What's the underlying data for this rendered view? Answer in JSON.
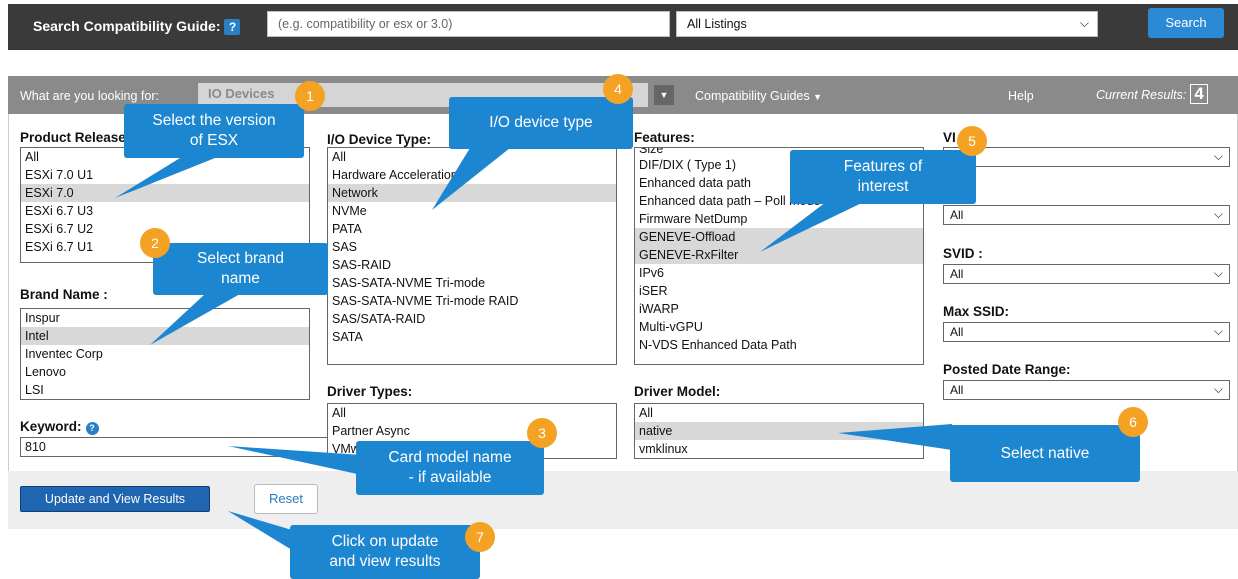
{
  "search_bar": {
    "label": "Search Compatibility Guide:",
    "help_icon": "?",
    "input_placeholder": "(e.g. compatibility or esx or 3.0)",
    "listing_value": "All Listings",
    "search_button": "Search"
  },
  "navbar": {
    "looking_for_label": "What are you looking for:",
    "looking_for_value": "IO Devices",
    "compatibility_guides": "Compatibility Guides",
    "help": "Help",
    "current_results_label": "Current Results:",
    "current_results_value": "4"
  },
  "product_release": {
    "label": "Product Release",
    "items": [
      "All",
      "ESXi 7.0 U1",
      "ESXi 7.0",
      "ESXi 6.7 U3",
      "ESXi 6.7 U2",
      "ESXi 6.7 U1"
    ]
  },
  "brand_name": {
    "label": "Brand Name :",
    "items": [
      "Inspur",
      "Intel",
      "Inventec Corp",
      "Lenovo",
      "LSI"
    ]
  },
  "keyword": {
    "label": "Keyword:",
    "value": "810"
  },
  "io_device_type": {
    "label": "I/O Device Type:",
    "items": [
      "All",
      "Hardware Acceleration",
      "Network",
      "NVMe",
      "PATA",
      "SAS",
      "SAS-RAID",
      "SAS-SATA-NVME Tri-mode",
      "SAS-SATA-NVME Tri-mode RAID",
      "SAS/SATA-RAID",
      "SATA"
    ]
  },
  "driver_types": {
    "label": "Driver Types:",
    "items": [
      "All",
      "Partner Async",
      "VMware Inbox"
    ]
  },
  "features": {
    "label": "Features:",
    "items": [
      "Size",
      "DIF/DIX ( Type 1)",
      "Enhanced data path",
      "Enhanced data path – Poll mode",
      "Firmware NetDump",
      "GENEVE-Offload",
      "GENEVE-RxFilter",
      "IPv6",
      "iSER",
      "iWARP",
      "Multi-vGPU",
      "N-VDS Enhanced Data Path"
    ]
  },
  "driver_model": {
    "label": "Driver Model:",
    "items": [
      "All",
      "native",
      "vmklinux"
    ]
  },
  "right_filters": {
    "vid_label": "VI",
    "ssid_value": "All",
    "svid_label": "SVID :",
    "svid_value": "All",
    "max_ssid_label": "Max SSID:",
    "max_ssid_value": "All",
    "posted_label": "Posted Date Range:",
    "posted_value": "All"
  },
  "buttons": {
    "update": "Update and View Results",
    "reset": "Reset"
  },
  "callouts": {
    "c1": {
      "num": "1",
      "line1": "Select the version",
      "line2": "of ESX"
    },
    "c2": {
      "num": "2",
      "line1": "Select brand",
      "line2": "name"
    },
    "c3": {
      "num": "3",
      "line1": "Card model name",
      "line2": "- if available"
    },
    "c4": {
      "num": "4",
      "line1": "I/O device type"
    },
    "c5": {
      "num": "5",
      "line1": "Features of",
      "line2": "interest"
    },
    "c6": {
      "num": "6",
      "line1": "Select native"
    },
    "c7": {
      "num": "7",
      "line1": "Click on update",
      "line2": "and view results"
    }
  },
  "colors": {
    "accent_blue": "#1d86d1",
    "badge_orange": "#f4a224",
    "top_bar": "#3a3a3a",
    "nav_bar": "#8a8a8a"
  }
}
